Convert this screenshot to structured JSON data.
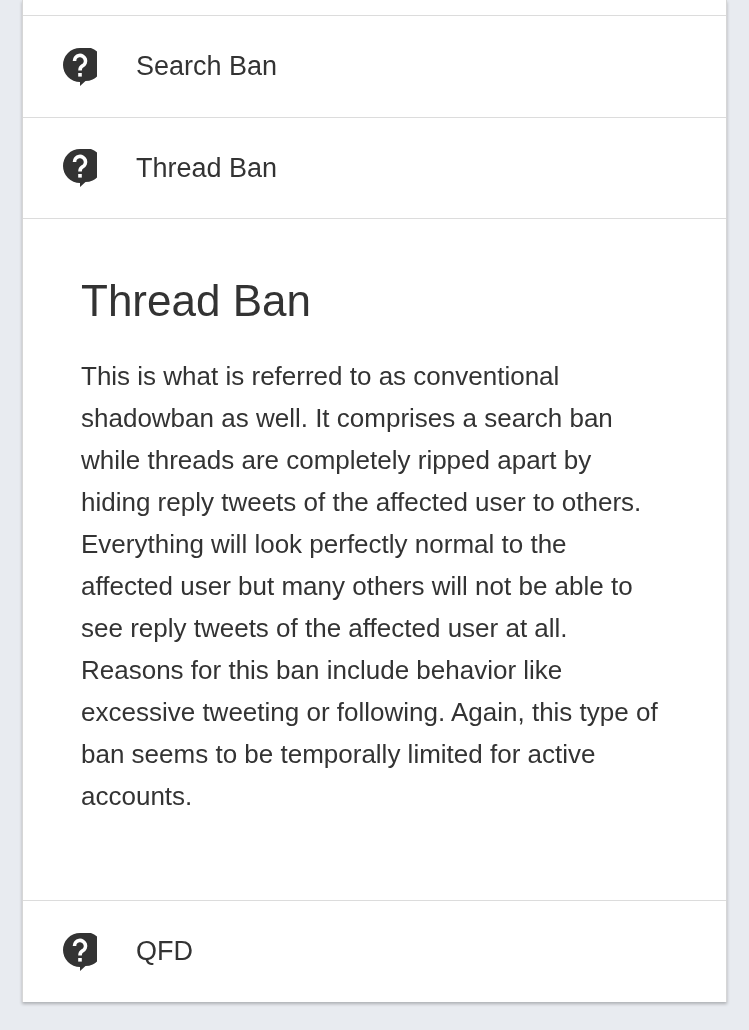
{
  "faq": {
    "items": [
      {
        "title": "Search Ban",
        "expanded": false
      },
      {
        "title": "Thread Ban",
        "expanded": true,
        "heading": "Thread Ban",
        "body": "This is what is referred to as conventional shadowban as well. It comprises a search ban while threads are completely ripped apart by hiding reply tweets of the affected user to others. Everything will look perfectly normal to the affected user but many others will not be able to see reply tweets of the affected user at all. Reasons for this ban include behavior like excessive tweeting or following. Again, this type of ban seems to be temporally limited for active accounts."
      },
      {
        "title": "QFD",
        "expanded": false
      }
    ]
  }
}
